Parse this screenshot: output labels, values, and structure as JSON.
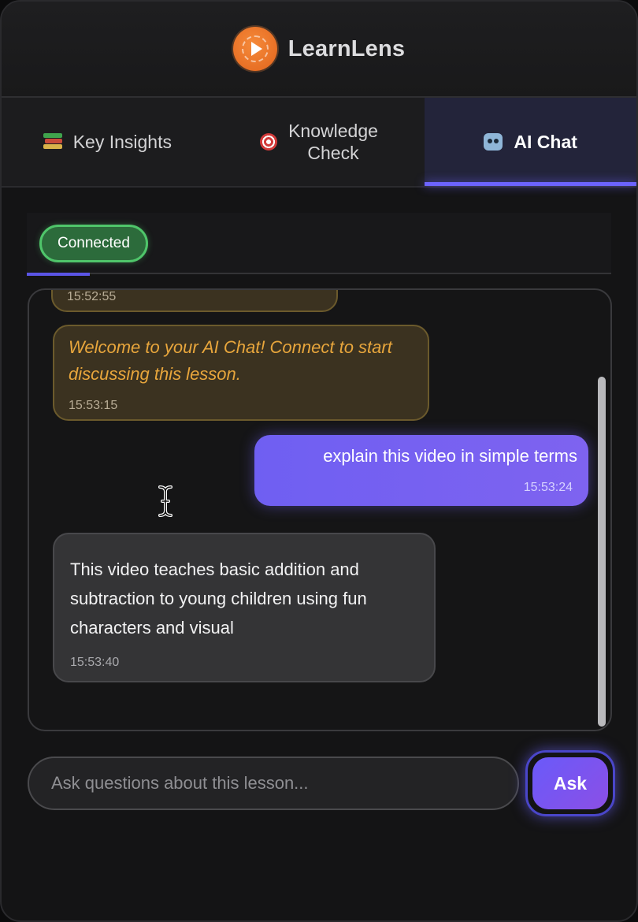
{
  "app": {
    "title": "LearnLens",
    "logo_icon": "play-logo-icon",
    "accent": "#6c63ff",
    "logo_color": "#e8702a"
  },
  "tabs": [
    {
      "label": "Key Insights",
      "icon": "books-icon",
      "active": false
    },
    {
      "label": "Knowledge\nCheck",
      "icon": "target-icon",
      "active": false
    },
    {
      "label": "AI Chat",
      "icon": "robot-icon",
      "active": true
    }
  ],
  "status": {
    "label": "Connected",
    "color": "#4fc56a"
  },
  "messages": [
    {
      "role": "system",
      "text": "",
      "time": "15:52:55"
    },
    {
      "role": "system",
      "text": "Welcome to your AI Chat! Connect to start discussing this lesson.",
      "time": "15:53:15"
    },
    {
      "role": "user",
      "text": "explain this video in simple terms",
      "time": "15:53:24"
    },
    {
      "role": "assistant",
      "text": "This video teaches basic addition and subtraction to young children using fun characters and visual",
      "time": "15:53:40"
    }
  ],
  "input": {
    "placeholder": "Ask questions about this lesson...",
    "value": ""
  },
  "ask_button": {
    "label": "Ask"
  }
}
